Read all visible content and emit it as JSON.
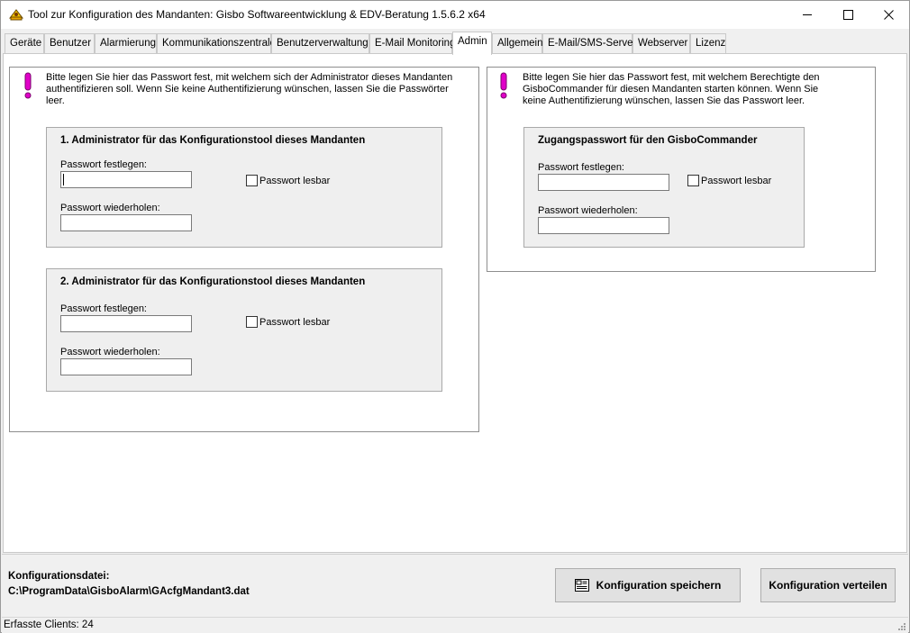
{
  "window": {
    "title": "Tool zur Konfiguration des Mandanten: Gisbo Softwareentwicklung & EDV-Beratung 1.5.6.2 x64"
  },
  "tabs": [
    {
      "label": "Geräte"
    },
    {
      "label": "Benutzer"
    },
    {
      "label": "Alarmierung"
    },
    {
      "label": "Kommunikationszentrale"
    },
    {
      "label": "Benutzerverwaltung"
    },
    {
      "label": "E-Mail Monitoring"
    },
    {
      "label": "Admin",
      "active": true
    },
    {
      "label": "Allgemein"
    },
    {
      "label": "E-Mail/SMS-Server"
    },
    {
      "label": "Webserver"
    },
    {
      "label": "Lizenz"
    }
  ],
  "admin_group": {
    "info": [
      "Bitte legen Sie hier das Passwort fest, mit welchem sich der Administrator dieses Mandanten",
      "authentifizieren soll. Wenn Sie keine Authentifizierung wünschen, lassen Sie die Passwörter",
      "leer."
    ],
    "admin1": {
      "title": "1. Administrator für das Konfigurationstool dieses Mandanten",
      "password_label": "Passwort festlegen:",
      "repeat_label": "Passwort wiederholen:",
      "show_label": "Passwort lesbar",
      "password_value": "",
      "repeat_value": ""
    },
    "admin2": {
      "title": "2. Administrator für das Konfigurationstool dieses Mandanten",
      "password_label": "Passwort festlegen:",
      "repeat_label": "Passwort wiederholen:",
      "show_label": "Passwort lesbar",
      "password_value": "",
      "repeat_value": ""
    }
  },
  "commander_group": {
    "info": [
      "Bitte legen Sie hier das Passwort fest, mit welchem Berechtigte den",
      "GisboCommander für diesen Mandanten starten können. Wenn Sie",
      "keine Authentifizierung wünschen, lassen Sie das Passwort leer."
    ],
    "title": "Zugangspasswort für den GisboCommander",
    "password_label": "Passwort festlegen:",
    "repeat_label": "Passwort wiederholen:",
    "show_label": "Passwort lesbar",
    "password_value": "",
    "repeat_value": ""
  },
  "footer": {
    "config_label": "Konfigurationsdatei:",
    "config_path": "C:\\ProgramData\\GisboAlarm\\GAcfgMandant3.dat",
    "save_button": "Konfiguration speichern",
    "distribute_button": "Konfiguration verteilen"
  },
  "status": {
    "text": "Erfasste Clients: 24"
  },
  "colors": {
    "warning_icon": "#e000c8",
    "panel_bg": "#efefef",
    "window_bg": "#f0f0f0"
  }
}
